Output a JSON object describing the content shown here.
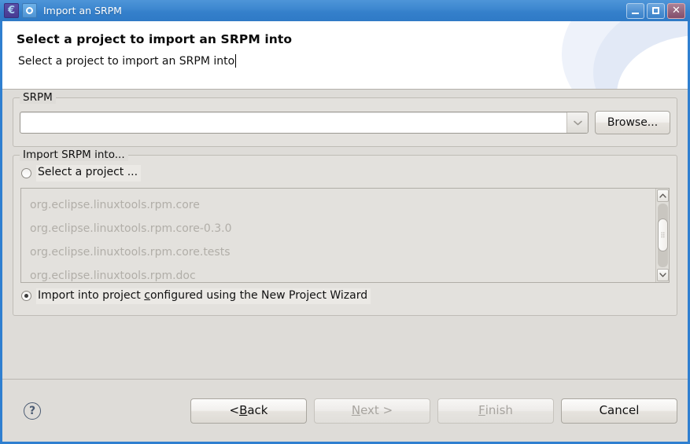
{
  "window": {
    "title": "Import an SRPM",
    "icons": {
      "app_icon": "eclipse-icon",
      "window_icon": "window-ring-icon"
    },
    "controls": {
      "minimize": "minimize-button",
      "maximize": "maximize-button",
      "close": "close-button"
    },
    "accent_color": "#3580cb",
    "body_color": "#dedcd8"
  },
  "header": {
    "title": "Select a project to import an SRPM into",
    "subtitle": "Select a project to import an SRPM into"
  },
  "srpm_group": {
    "title": "SRPM",
    "combo": {
      "value": "",
      "placeholder": ""
    },
    "browse_label": "Browse..."
  },
  "import_group": {
    "title": "Import SRPM into...",
    "option_select_project": {
      "label": "Select a project ...",
      "checked": false
    },
    "option_new_wizard": {
      "label_before": "Import into project ",
      "mnemonic": "c",
      "label_after": "onfigured using the New Project Wizard",
      "checked": true
    },
    "projects": [
      "org.eclipse.linuxtools.rpm.core",
      "org.eclipse.linuxtools.rpm.core-0.3.0",
      "org.eclipse.linuxtools.rpm.core.tests",
      "org.eclipse.linuxtools.rpm.doc"
    ],
    "projects_enabled": false
  },
  "footer": {
    "help_label": "?",
    "buttons": [
      {
        "name": "back-button",
        "prefix": "< ",
        "mnemonic": "B",
        "suffix": "ack",
        "disabled": false
      },
      {
        "name": "next-button",
        "prefix": "",
        "mnemonic": "N",
        "suffix": "ext >",
        "disabled": true
      },
      {
        "name": "finish-button",
        "prefix": "",
        "mnemonic": "F",
        "suffix": "inish",
        "disabled": true
      },
      {
        "name": "cancel-button",
        "prefix": "",
        "mnemonic": "",
        "suffix": "Cancel",
        "disabled": false
      }
    ]
  }
}
